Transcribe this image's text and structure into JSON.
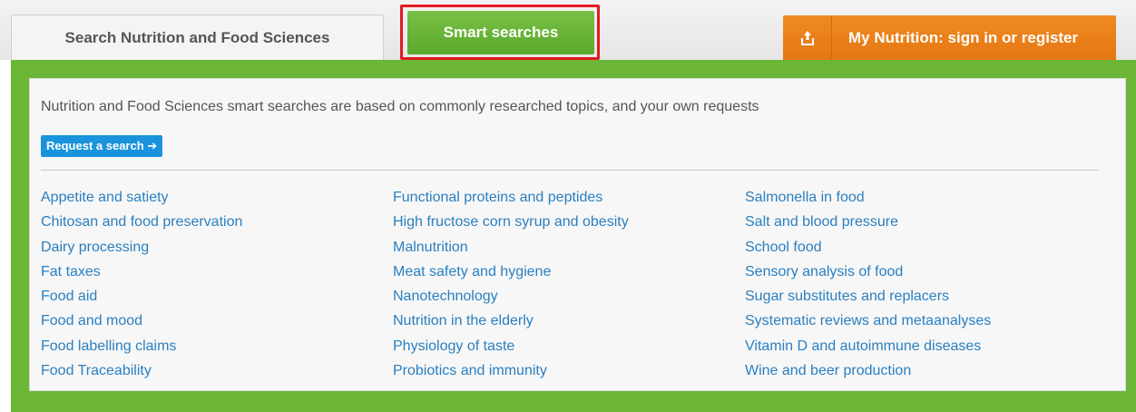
{
  "tabs": {
    "search_label": "Search Nutrition and Food Sciences",
    "smart_label": "Smart searches",
    "account_icon": "upload-icon",
    "account_label": "My Nutrition: sign in or register"
  },
  "panel": {
    "intro": "Nutrition and Food Sciences smart searches are based on commonly researched topics, and your own requests",
    "request_button": "Request a search ➔"
  },
  "topics": {
    "col1": [
      "Appetite and satiety",
      "Chitosan and food preservation",
      "Dairy processing",
      "Fat taxes",
      "Food aid",
      "Food and mood",
      "Food labelling claims",
      "Food Traceability"
    ],
    "col2": [
      "Functional proteins and peptides",
      "High fructose corn syrup and obesity",
      "Malnutrition",
      "Meat safety and hygiene",
      "Nanotechnology",
      "Nutrition in the elderly",
      "Physiology of taste",
      "Probiotics and immunity"
    ],
    "col3": [
      "Salmonella in food",
      "Salt and blood pressure",
      "School food",
      "Sensory analysis of food",
      "Sugar substitutes and replacers",
      "Systematic reviews and metaanalyses",
      "Vitamin D and autoimmune diseases",
      "Wine and beer production"
    ]
  },
  "colors": {
    "green": "#6cb637",
    "orange": "#e57713",
    "link": "#2a7fc0",
    "highlight": "#e3191f"
  }
}
